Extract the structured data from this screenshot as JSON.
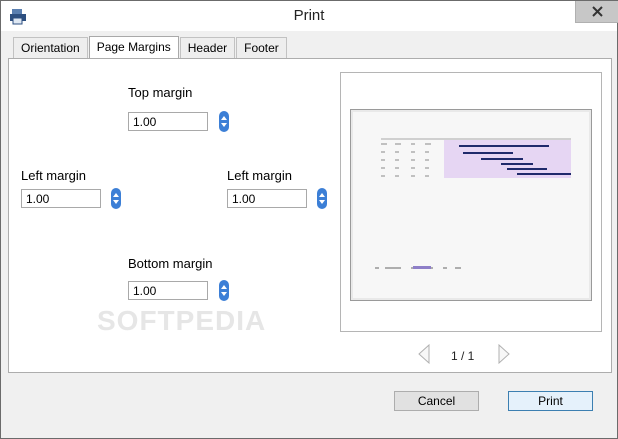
{
  "window": {
    "title": "Print"
  },
  "tabs": [
    {
      "label": "Orientation",
      "active": false
    },
    {
      "label": "Page Margins",
      "active": true
    },
    {
      "label": "Header",
      "active": false
    },
    {
      "label": "Footer",
      "active": false
    }
  ],
  "margins": {
    "top": {
      "label": "Top margin",
      "value": "1.00"
    },
    "left": {
      "label": "Left margin",
      "value": "1.00"
    },
    "right": {
      "label": "Left margin",
      "value": "1.00"
    },
    "bottom": {
      "label": "Bottom margin",
      "value": "1.00"
    }
  },
  "preview": {
    "page_info": "1 / 1"
  },
  "buttons": {
    "cancel": "Cancel",
    "print": "Print"
  },
  "watermark": "SOFTPEDIA",
  "colors": {
    "accent": "#3c7fd6",
    "gantt_bar": "#1f2a6b",
    "gantt_fill": "#e6d6f3"
  },
  "icons": {
    "app": "print-app-icon",
    "close": "close-icon",
    "prev": "chevron-left-icon",
    "next": "chevron-right-icon"
  }
}
